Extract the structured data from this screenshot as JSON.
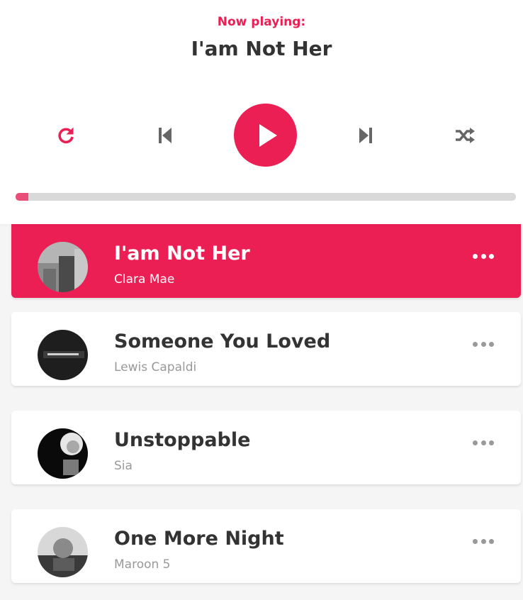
{
  "header": {
    "now_playing_label": "Now playing:",
    "current_song_title": "I'am Not Her"
  },
  "controls": {
    "icons": [
      "repeat-icon",
      "step-backward-icon",
      "play-icon",
      "step-forward-icon",
      "random-icon"
    ]
  },
  "progress": {
    "fraction": 0.025
  },
  "playlist": {
    "songs": [
      {
        "title": "I'am Not Her",
        "author": "Clara Mae",
        "active": true
      },
      {
        "title": "Someone You Loved",
        "author": "Lewis Capaldi",
        "active": false
      },
      {
        "title": "Unstoppable",
        "author": "Sia",
        "active": false
      },
      {
        "title": "One More Night",
        "author": "Maroon 5",
        "active": false
      }
    ]
  },
  "colors": {
    "accent": "#ec1f55",
    "text": "#333333",
    "muted": "#999999",
    "track": "#d9d9d9"
  }
}
